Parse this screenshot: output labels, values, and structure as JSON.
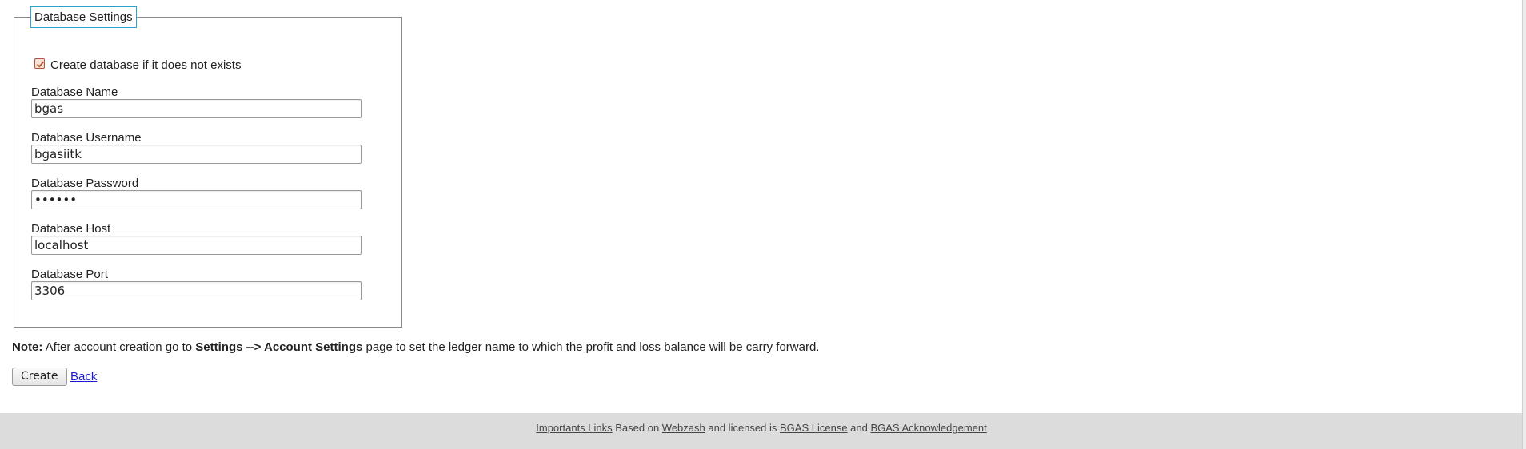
{
  "form": {
    "legend": "Database Settings",
    "create_db_checkbox": {
      "label": "Create database if it does not exists",
      "checked": true
    },
    "fields": {
      "db_name": {
        "label": "Database Name",
        "value": "bgas"
      },
      "db_username": {
        "label": "Database Username",
        "value": "bgasiitk"
      },
      "db_password": {
        "label": "Database Password",
        "value": "••••••"
      },
      "db_host": {
        "label": "Database Host",
        "value": "localhost"
      },
      "db_port": {
        "label": "Database Port",
        "value": "3306"
      }
    }
  },
  "note": {
    "prefix": "Note:",
    "text_before": " After account creation go to ",
    "bold_path": "Settings --> Account Settings",
    "text_after": " page to set the ledger name to which the profit and loss balance will be carry forward."
  },
  "actions": {
    "create_label": "Create",
    "back_label": "Back"
  },
  "footer": {
    "link_important": "Importants Links",
    "text_based": " Based on ",
    "link_webzash": "Webzash",
    "text_licensed": " and licensed is ",
    "link_license": "BGAS License",
    "text_and": " and ",
    "link_ack": "BGAS Acknowledgement"
  },
  "colors": {
    "legend_border": "#2aa3cf",
    "checkbox_accent": "#b5552f",
    "link": "#1a1ad6",
    "footer_bg": "#dcdcdc"
  }
}
